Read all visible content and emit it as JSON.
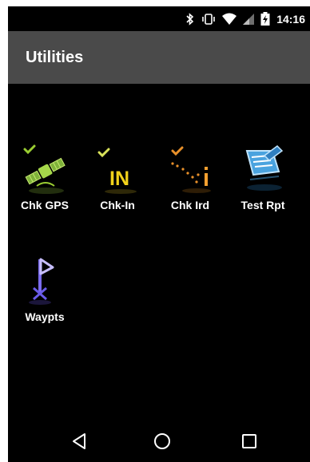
{
  "status_bar": {
    "time": "14:16",
    "icons": [
      "bluetooth-icon",
      "vibrate-icon",
      "wifi-icon",
      "signal-icon",
      "battery-charging-icon"
    ]
  },
  "app_bar": {
    "title": "Utilities"
  },
  "apps": [
    {
      "label": "Chk GPS",
      "icon": "satellite-check-icon"
    },
    {
      "label": "Chk-In",
      "icon": "check-in-icon"
    },
    {
      "label": "Chk Ird",
      "icon": "iridium-check-icon"
    },
    {
      "label": "Test Rpt",
      "icon": "report-icon"
    },
    {
      "label": "Waypts",
      "icon": "waypoint-flag-icon"
    }
  ],
  "nav_bar": {
    "buttons": [
      "back-icon",
      "home-icon",
      "recents-icon"
    ]
  },
  "colors": {
    "app_bar": "#4a4a4a",
    "background": "#000000",
    "gps_green": "#9acd32",
    "checkin_yellow": "#f2d21b",
    "ird_orange": "#e8902a",
    "report_blue": "#4aa3df",
    "waypoint_purple": "#7b6cf0"
  }
}
